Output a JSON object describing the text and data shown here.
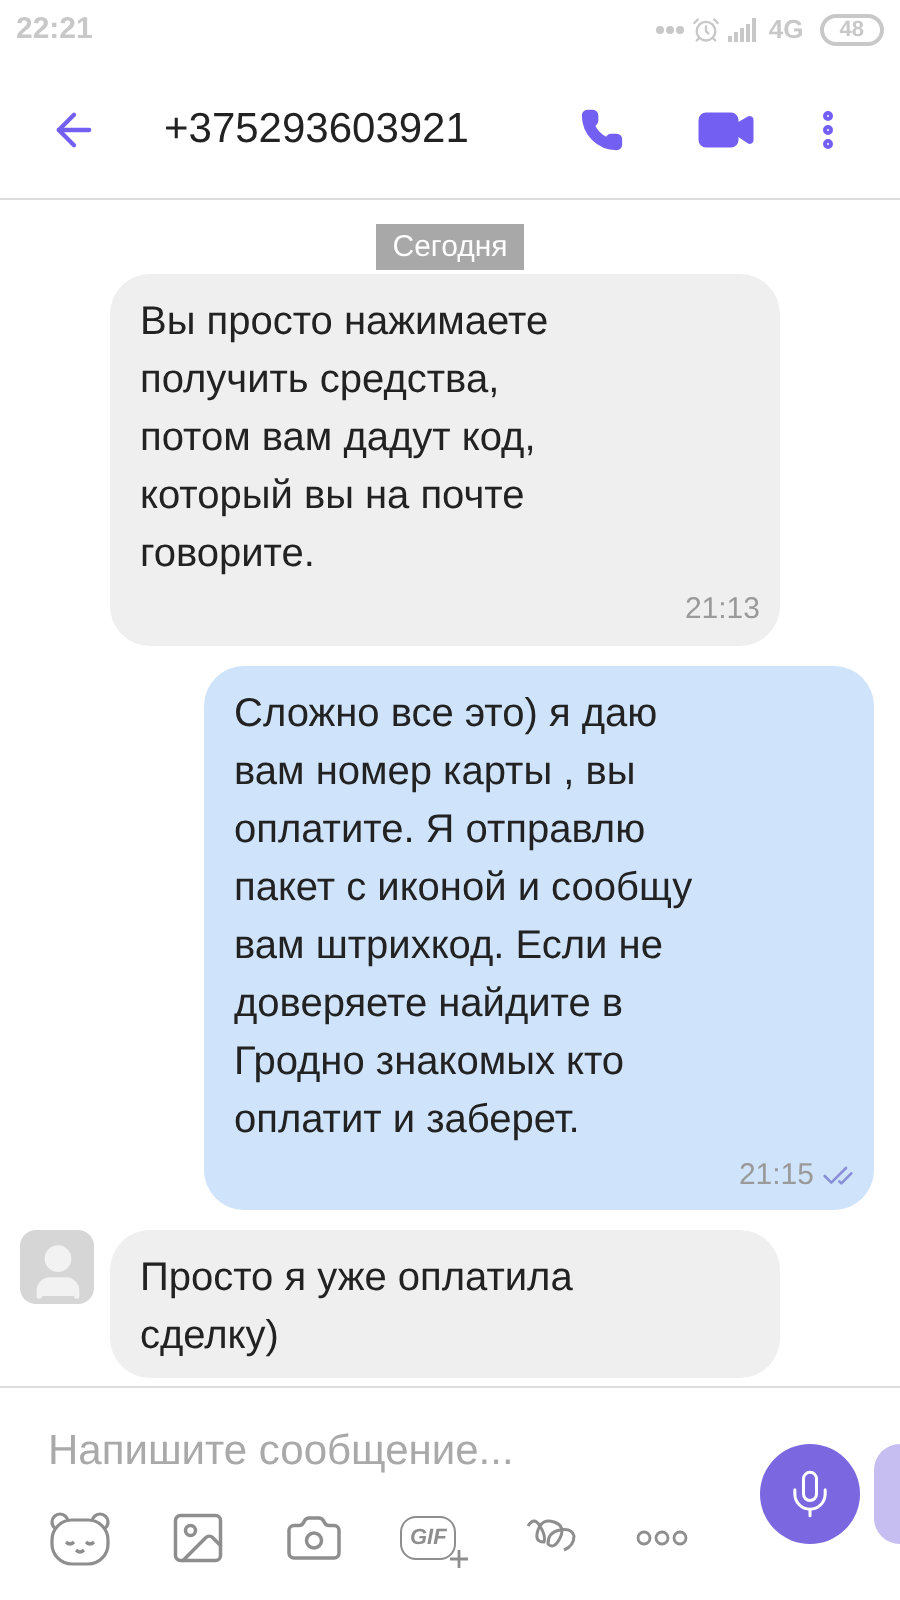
{
  "status_bar": {
    "time": "22:21",
    "network": "4G",
    "battery": "48"
  },
  "header": {
    "title": "+375293603921"
  },
  "date_chip": "Сегодня",
  "messages": [
    {
      "kind": "incoming",
      "text": "Вы просто нажимаете\nполучить средства,\nпотом вам дадут код,\nкоторый вы на почте\nговорите.",
      "time": "21:13",
      "show_avatar": false
    },
    {
      "kind": "outgoing",
      "text": "Сложно все это) я даю\nвам номер карты , вы\nоплатите. Я отправлю\nпакет с иконой и сообщу\nвам штрихкод. Если не\nдоверяете найдите в\nГродно знакомых кто\nоплатит и заберет.",
      "time": "21:15",
      "read": true
    },
    {
      "kind": "incoming",
      "text": "Просто я уже оплатила\nсделку)",
      "show_avatar": true
    }
  ],
  "composer": {
    "placeholder": "Напишите сообщение...",
    "gif_label": "GIF"
  }
}
